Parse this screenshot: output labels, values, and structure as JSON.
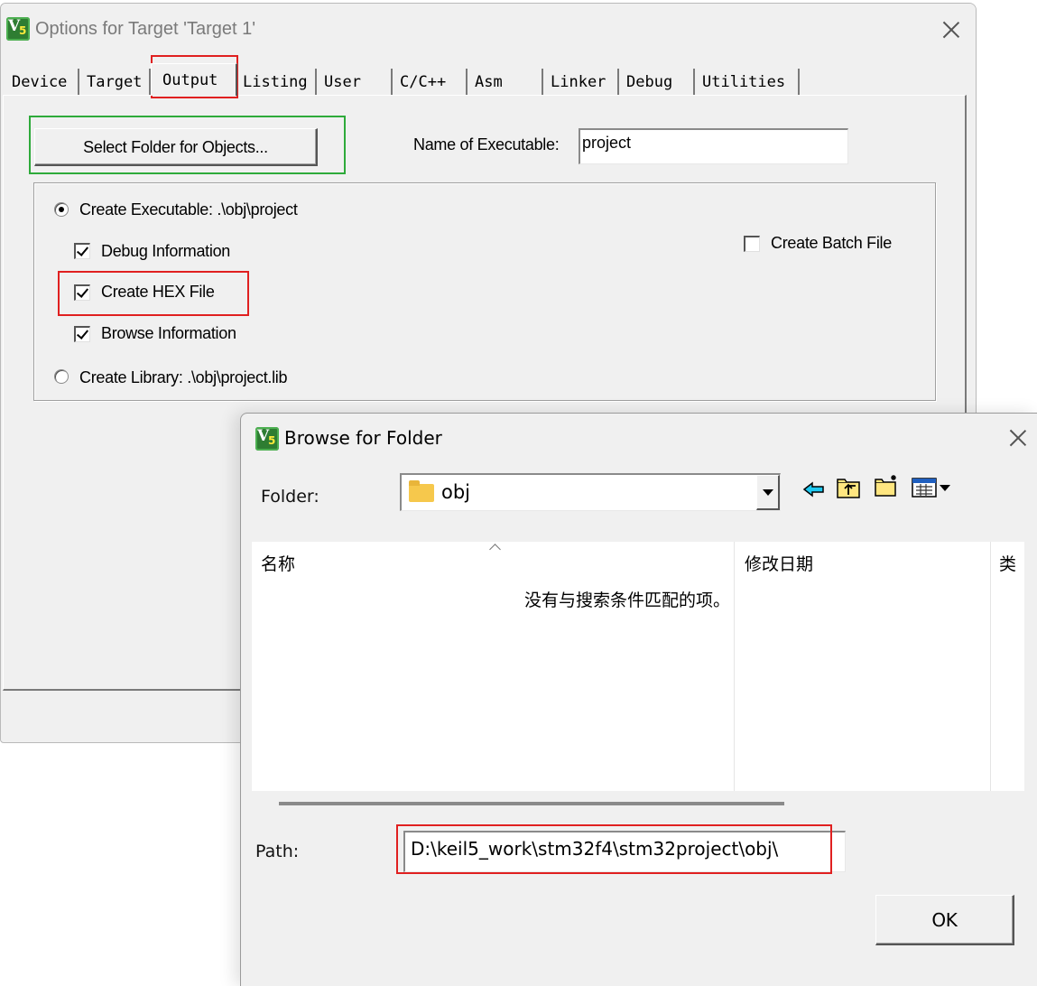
{
  "options_window": {
    "title": "Options for Target 'Target 1'",
    "tabs": [
      "Device",
      "Target",
      "Output",
      "Listing",
      "User",
      "C/C++",
      "Asm",
      "Linker",
      "Debug",
      "Utilities"
    ],
    "active_tab": "Output",
    "select_folder_label": "Select Folder for Objects...",
    "name_of_executable_label": "Name of Executable:",
    "name_of_executable_value": "project",
    "create_executable_label": "Create Executable:  .\\obj\\project",
    "debug_information_label": "Debug Information",
    "create_hex_label": "Create HEX File",
    "browse_information_label": "Browse Information",
    "create_library_label": "Create Library:  .\\obj\\project.lib",
    "create_batch_label": "Create Batch File",
    "state": {
      "create_executable": true,
      "create_library": false,
      "debug_information": true,
      "create_hex": true,
      "browse_information": true,
      "create_batch": false
    }
  },
  "browse_dialog": {
    "title": "Browse for Folder",
    "folder_label": "Folder:",
    "folder_value": "obj",
    "columns": [
      "名称",
      "修改日期",
      "类"
    ],
    "empty_message": "没有与搜索条件匹配的项。",
    "path_label": "Path:",
    "path_value": "D:\\keil5_work\\stm32f4\\stm32project\\obj\\",
    "ok_label": "OK",
    "icons": [
      "back-arrow-icon",
      "up-folder-icon",
      "new-folder-icon",
      "view-menu-icon"
    ]
  },
  "colors": {
    "highlight_red": "#e02020",
    "highlight_green": "#2eaa3a",
    "dialog_bg": "#f0f0f0"
  }
}
